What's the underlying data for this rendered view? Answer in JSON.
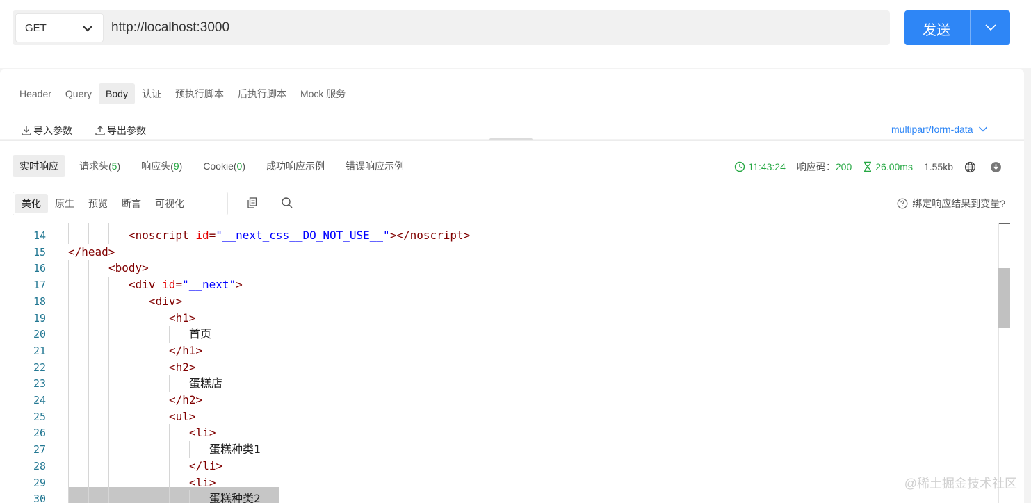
{
  "request": {
    "method": "GET",
    "url": "http://localhost:3000",
    "send_label": "发送"
  },
  "tabs": [
    {
      "label": "Header",
      "active": false
    },
    {
      "label": "Query",
      "active": false
    },
    {
      "label": "Body",
      "active": true
    },
    {
      "label": "认证",
      "active": false
    },
    {
      "label": "预执行脚本",
      "active": false
    },
    {
      "label": "后执行脚本",
      "active": false
    },
    {
      "label": "Mock 服务",
      "active": false
    }
  ],
  "params": {
    "import_label": "导入参数",
    "export_label": "导出参数",
    "content_type": "multipart/form-data"
  },
  "response": {
    "tabs": [
      {
        "label": "实时响应",
        "count": "",
        "active": true
      },
      {
        "label": "请求头",
        "count": "5",
        "active": false
      },
      {
        "label": "响应头",
        "count": "9",
        "active": false
      },
      {
        "label": "Cookie",
        "count": "0",
        "active": false
      },
      {
        "label": "成功响应示例",
        "count": "",
        "active": false
      },
      {
        "label": "错误响应示例",
        "count": "",
        "active": false
      }
    ],
    "time": "11:43:24",
    "status_label": "响应码：",
    "status_code": "200",
    "duration": "26.00ms",
    "size": "1.55kb",
    "view_tabs": [
      {
        "label": "美化",
        "active": true
      },
      {
        "label": "原生",
        "active": false
      },
      {
        "label": "预览",
        "active": false
      },
      {
        "label": "断言",
        "active": false
      },
      {
        "label": "可视化",
        "active": false
      }
    ],
    "bind_label": "绑定响应结果到变量?"
  },
  "code": [
    {
      "n": "14",
      "indent": 3,
      "parts": [
        [
          "tag",
          "<noscript "
        ],
        [
          "attr",
          "id"
        ],
        [
          "tag",
          "="
        ],
        [
          "str",
          "\"__next_css__DO_NOT_USE__\""
        ],
        [
          "tag",
          "></noscript>"
        ]
      ]
    },
    {
      "n": "15",
      "indent": 0,
      "parts": [
        [
          "tag",
          "</head>"
        ]
      ]
    },
    {
      "n": "16",
      "indent": 2,
      "parts": [
        [
          "tag",
          "<body>"
        ]
      ]
    },
    {
      "n": "17",
      "indent": 3,
      "parts": [
        [
          "tag",
          "<div "
        ],
        [
          "attr",
          "id"
        ],
        [
          "tag",
          "="
        ],
        [
          "str",
          "\"__next\""
        ],
        [
          "tag",
          ">"
        ]
      ]
    },
    {
      "n": "18",
      "indent": 4,
      "parts": [
        [
          "tag",
          "<div>"
        ]
      ]
    },
    {
      "n": "19",
      "indent": 5,
      "parts": [
        [
          "tag",
          "<h1>"
        ]
      ]
    },
    {
      "n": "20",
      "indent": 6,
      "parts": [
        [
          "txt",
          "首页"
        ]
      ]
    },
    {
      "n": "21",
      "indent": 5,
      "parts": [
        [
          "tag",
          "</h1>"
        ]
      ]
    },
    {
      "n": "22",
      "indent": 5,
      "parts": [
        [
          "tag",
          "<h2>"
        ]
      ]
    },
    {
      "n": "23",
      "indent": 6,
      "parts": [
        [
          "txt",
          "蛋糕店"
        ]
      ]
    },
    {
      "n": "24",
      "indent": 5,
      "parts": [
        [
          "tag",
          "</h2>"
        ]
      ]
    },
    {
      "n": "25",
      "indent": 5,
      "parts": [
        [
          "tag",
          "<ul>"
        ]
      ]
    },
    {
      "n": "26",
      "indent": 6,
      "parts": [
        [
          "tag",
          "<li>"
        ]
      ]
    },
    {
      "n": "27",
      "indent": 7,
      "parts": [
        [
          "txt",
          "蛋糕种类1"
        ]
      ]
    },
    {
      "n": "28",
      "indent": 6,
      "parts": [
        [
          "tag",
          "</li>"
        ]
      ]
    },
    {
      "n": "29",
      "indent": 6,
      "parts": [
        [
          "tag",
          "<li>"
        ]
      ]
    },
    {
      "n": "30",
      "indent": 7,
      "parts": [
        [
          "txt",
          "蛋糕种类2"
        ]
      ]
    }
  ],
  "watermark": "@稀土掘金技术社区",
  "colors": {
    "accent": "#2e86f6",
    "success": "#27a844"
  }
}
